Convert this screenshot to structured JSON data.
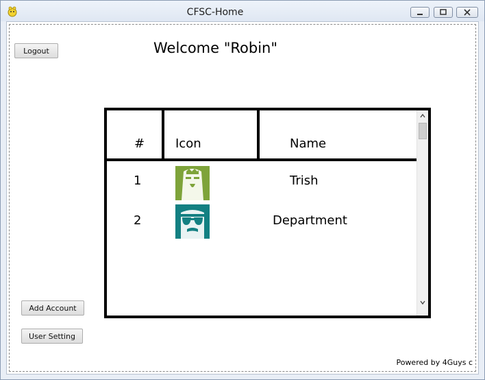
{
  "window": {
    "title": "CFSC-Home"
  },
  "toolbar": {
    "logout_label": "Logout"
  },
  "welcome": {
    "text": "Welcome \"Robin\""
  },
  "table": {
    "headers": [
      "#",
      "Icon",
      "Name"
    ],
    "rows": [
      {
        "num": "1",
        "icon": "green-face-avatar-icon",
        "name": "Trish"
      },
      {
        "num": "2",
        "icon": "teal-sunglasses-avatar-icon",
        "name": "Department"
      }
    ]
  },
  "sidebar": {
    "add_account_label": "Add Account",
    "user_setting_label": "User Setting"
  },
  "footer": {
    "powered_text": "Powered by 4Guys c"
  },
  "colors": {
    "avatar_green": "#7ea33a",
    "avatar_teal": "#138082"
  }
}
